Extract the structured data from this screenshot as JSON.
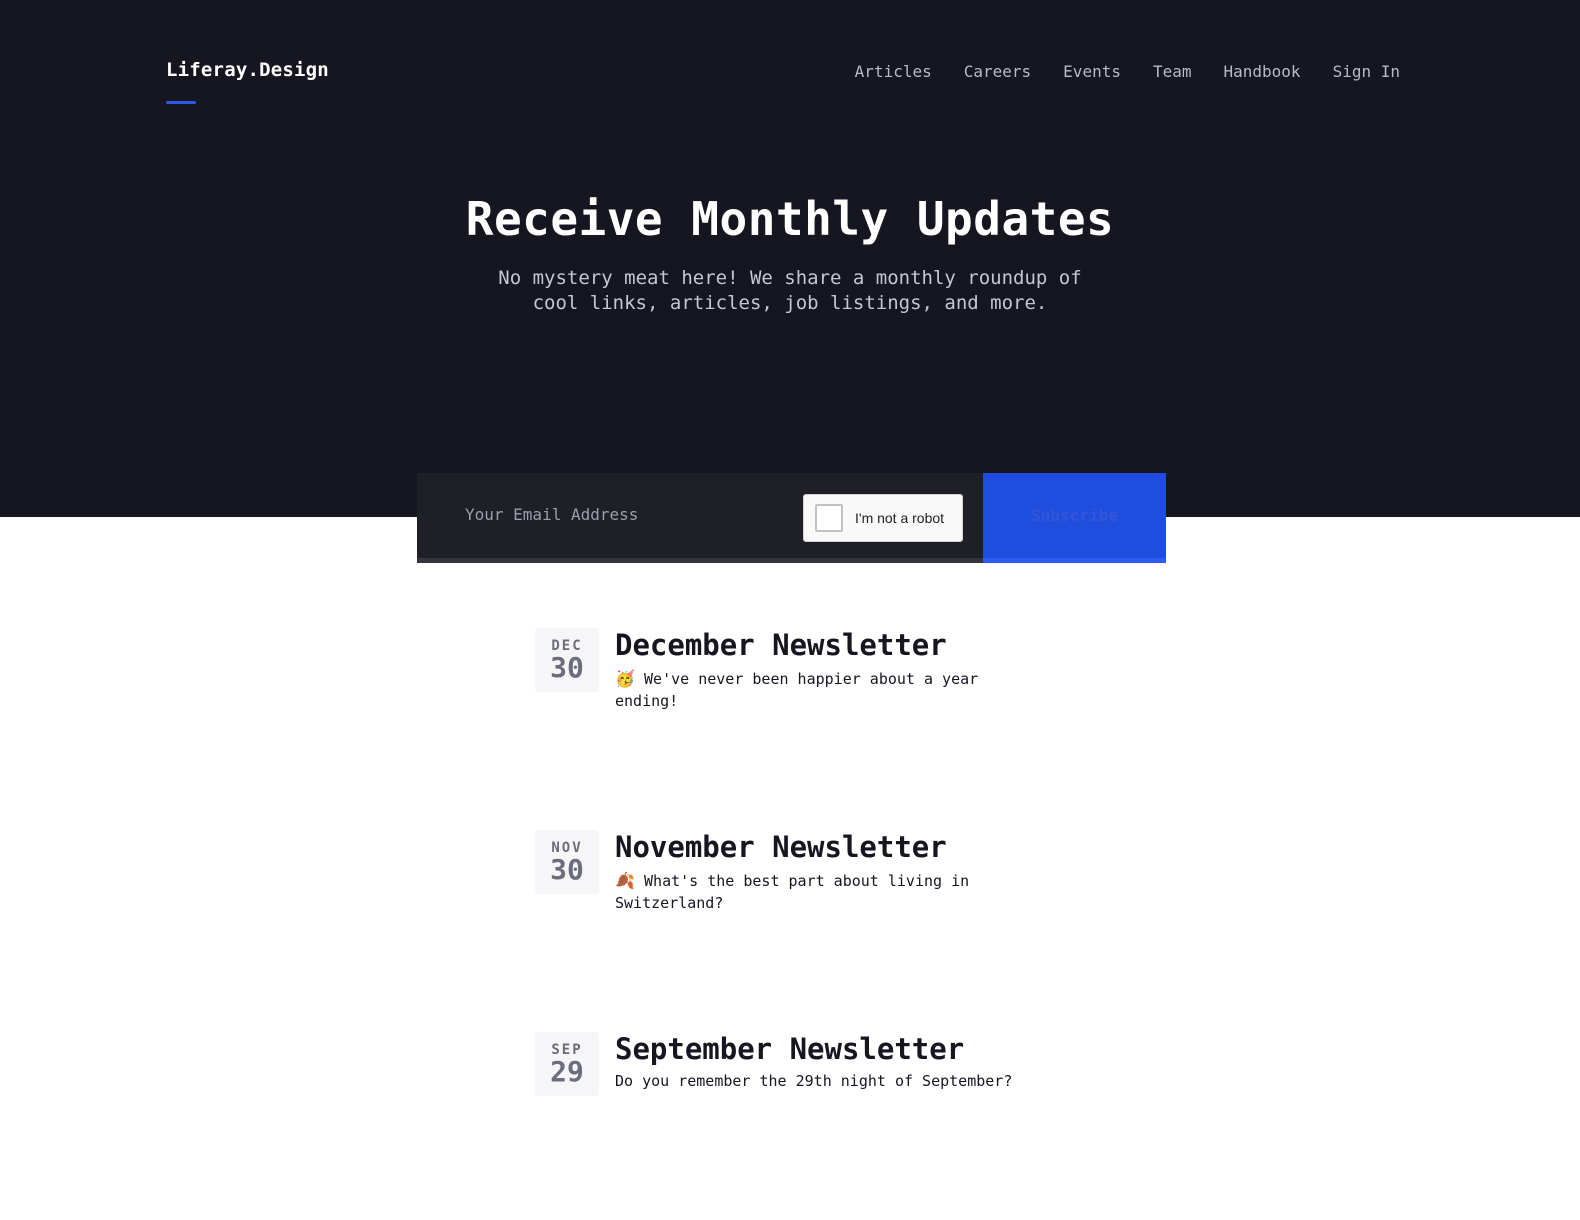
{
  "header": {
    "logo": "Liferay.Design",
    "nav": [
      {
        "label": "Articles"
      },
      {
        "label": "Careers"
      },
      {
        "label": "Events"
      },
      {
        "label": "Team"
      },
      {
        "label": "Handbook"
      },
      {
        "label": "Sign In"
      }
    ]
  },
  "hero": {
    "title": "Receive Monthly Updates",
    "subtitle": "No mystery meat here! We share a monthly roundup of cool links, articles, job listings, and more."
  },
  "form": {
    "email_placeholder": "Your Email Address",
    "captcha_label": "I'm not a robot",
    "subscribe_label": "Subscribe"
  },
  "posts": [
    {
      "month": "DEC",
      "day": "30",
      "title": "December Newsletter",
      "emoji": "🥳",
      "text": "We've never been happier about a year ending!"
    },
    {
      "month": "NOV",
      "day": "30",
      "title": "November Newsletter",
      "emoji": "🍂",
      "text": "What's the best part about living in Switzerland?"
    },
    {
      "month": "SEP",
      "day": "29",
      "title": "September Newsletter",
      "emoji": "",
      "text": "Do you remember the 29th night of September?"
    }
  ],
  "colors": {
    "hero_bg": "#151620",
    "accent": "#2b57f0",
    "subscribe_bg": "#1f4ddd"
  }
}
